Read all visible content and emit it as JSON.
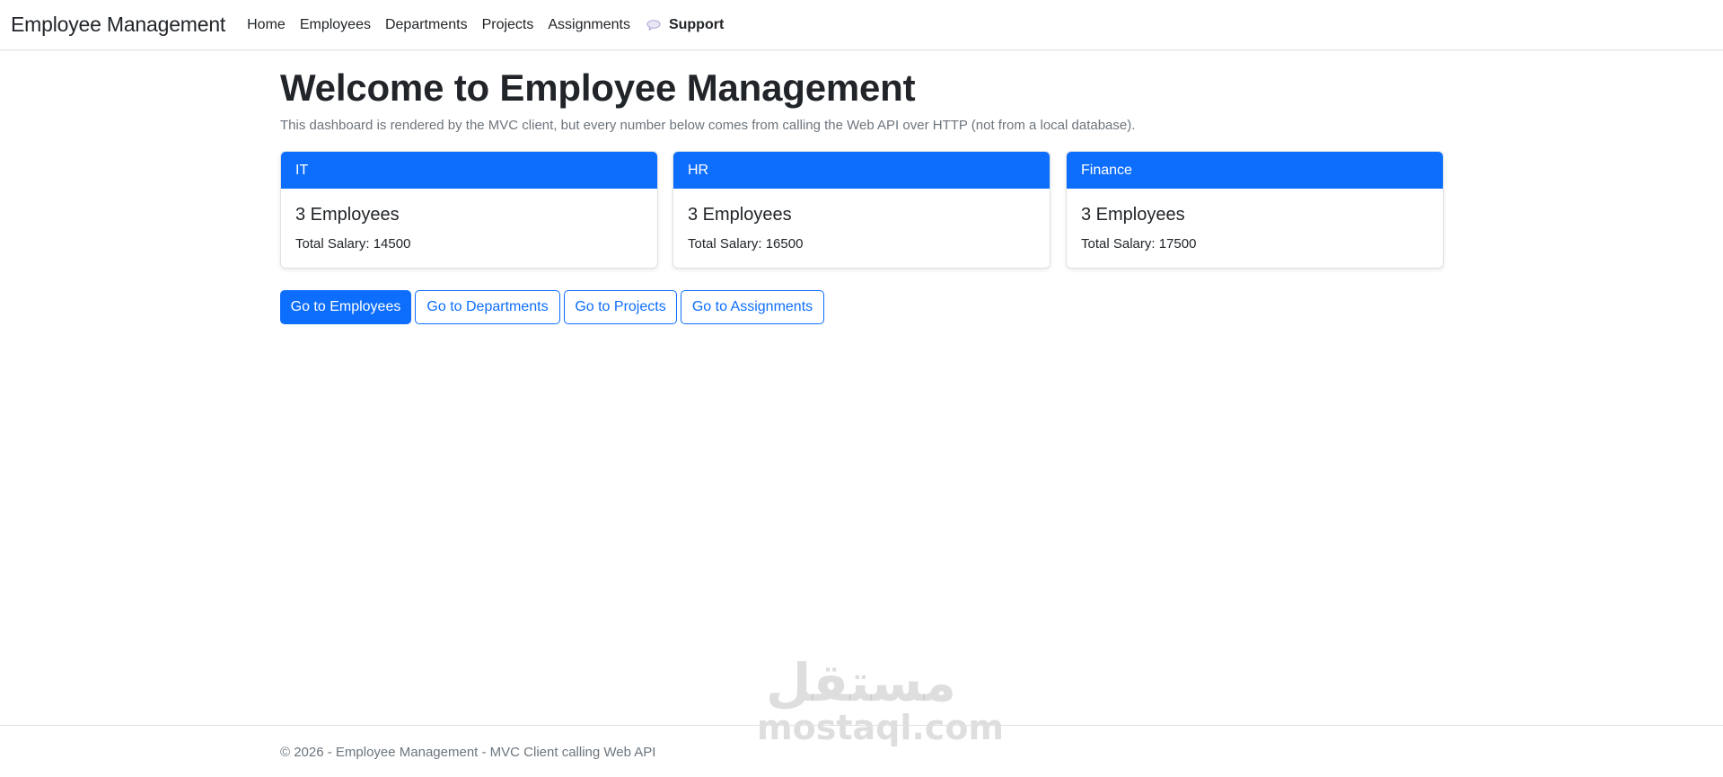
{
  "navbar": {
    "brand": "Employee Management",
    "links": [
      "Home",
      "Employees",
      "Departments",
      "Projects",
      "Assignments"
    ],
    "support_label": "Support"
  },
  "main": {
    "title": "Welcome to Employee Management",
    "lead": "This dashboard is rendered by the MVC client, but every number below comes from calling the Web API over HTTP (not from a local database).",
    "cards": [
      {
        "header": "IT",
        "title": "3 Employees",
        "text": "Total Salary: 14500"
      },
      {
        "header": "HR",
        "title": "3 Employees",
        "text": "Total Salary: 16500"
      },
      {
        "header": "Finance",
        "title": "3 Employees",
        "text": "Total Salary: 17500"
      }
    ],
    "buttons": [
      "Go to Employees",
      "Go to Departments",
      "Go to Projects",
      "Go to Assignments"
    ]
  },
  "footer": {
    "text": "© 2026 - Employee Management - MVC Client calling Web API"
  },
  "watermark": {
    "arabic": "مستقل",
    "latin": "mostaql.com"
  },
  "colors": {
    "primary": "#0d6efd",
    "text": "#212529",
    "muted": "#6c757d",
    "border": "#dee2e6"
  },
  "icons": {
    "support": "speech-bubble-icon"
  }
}
